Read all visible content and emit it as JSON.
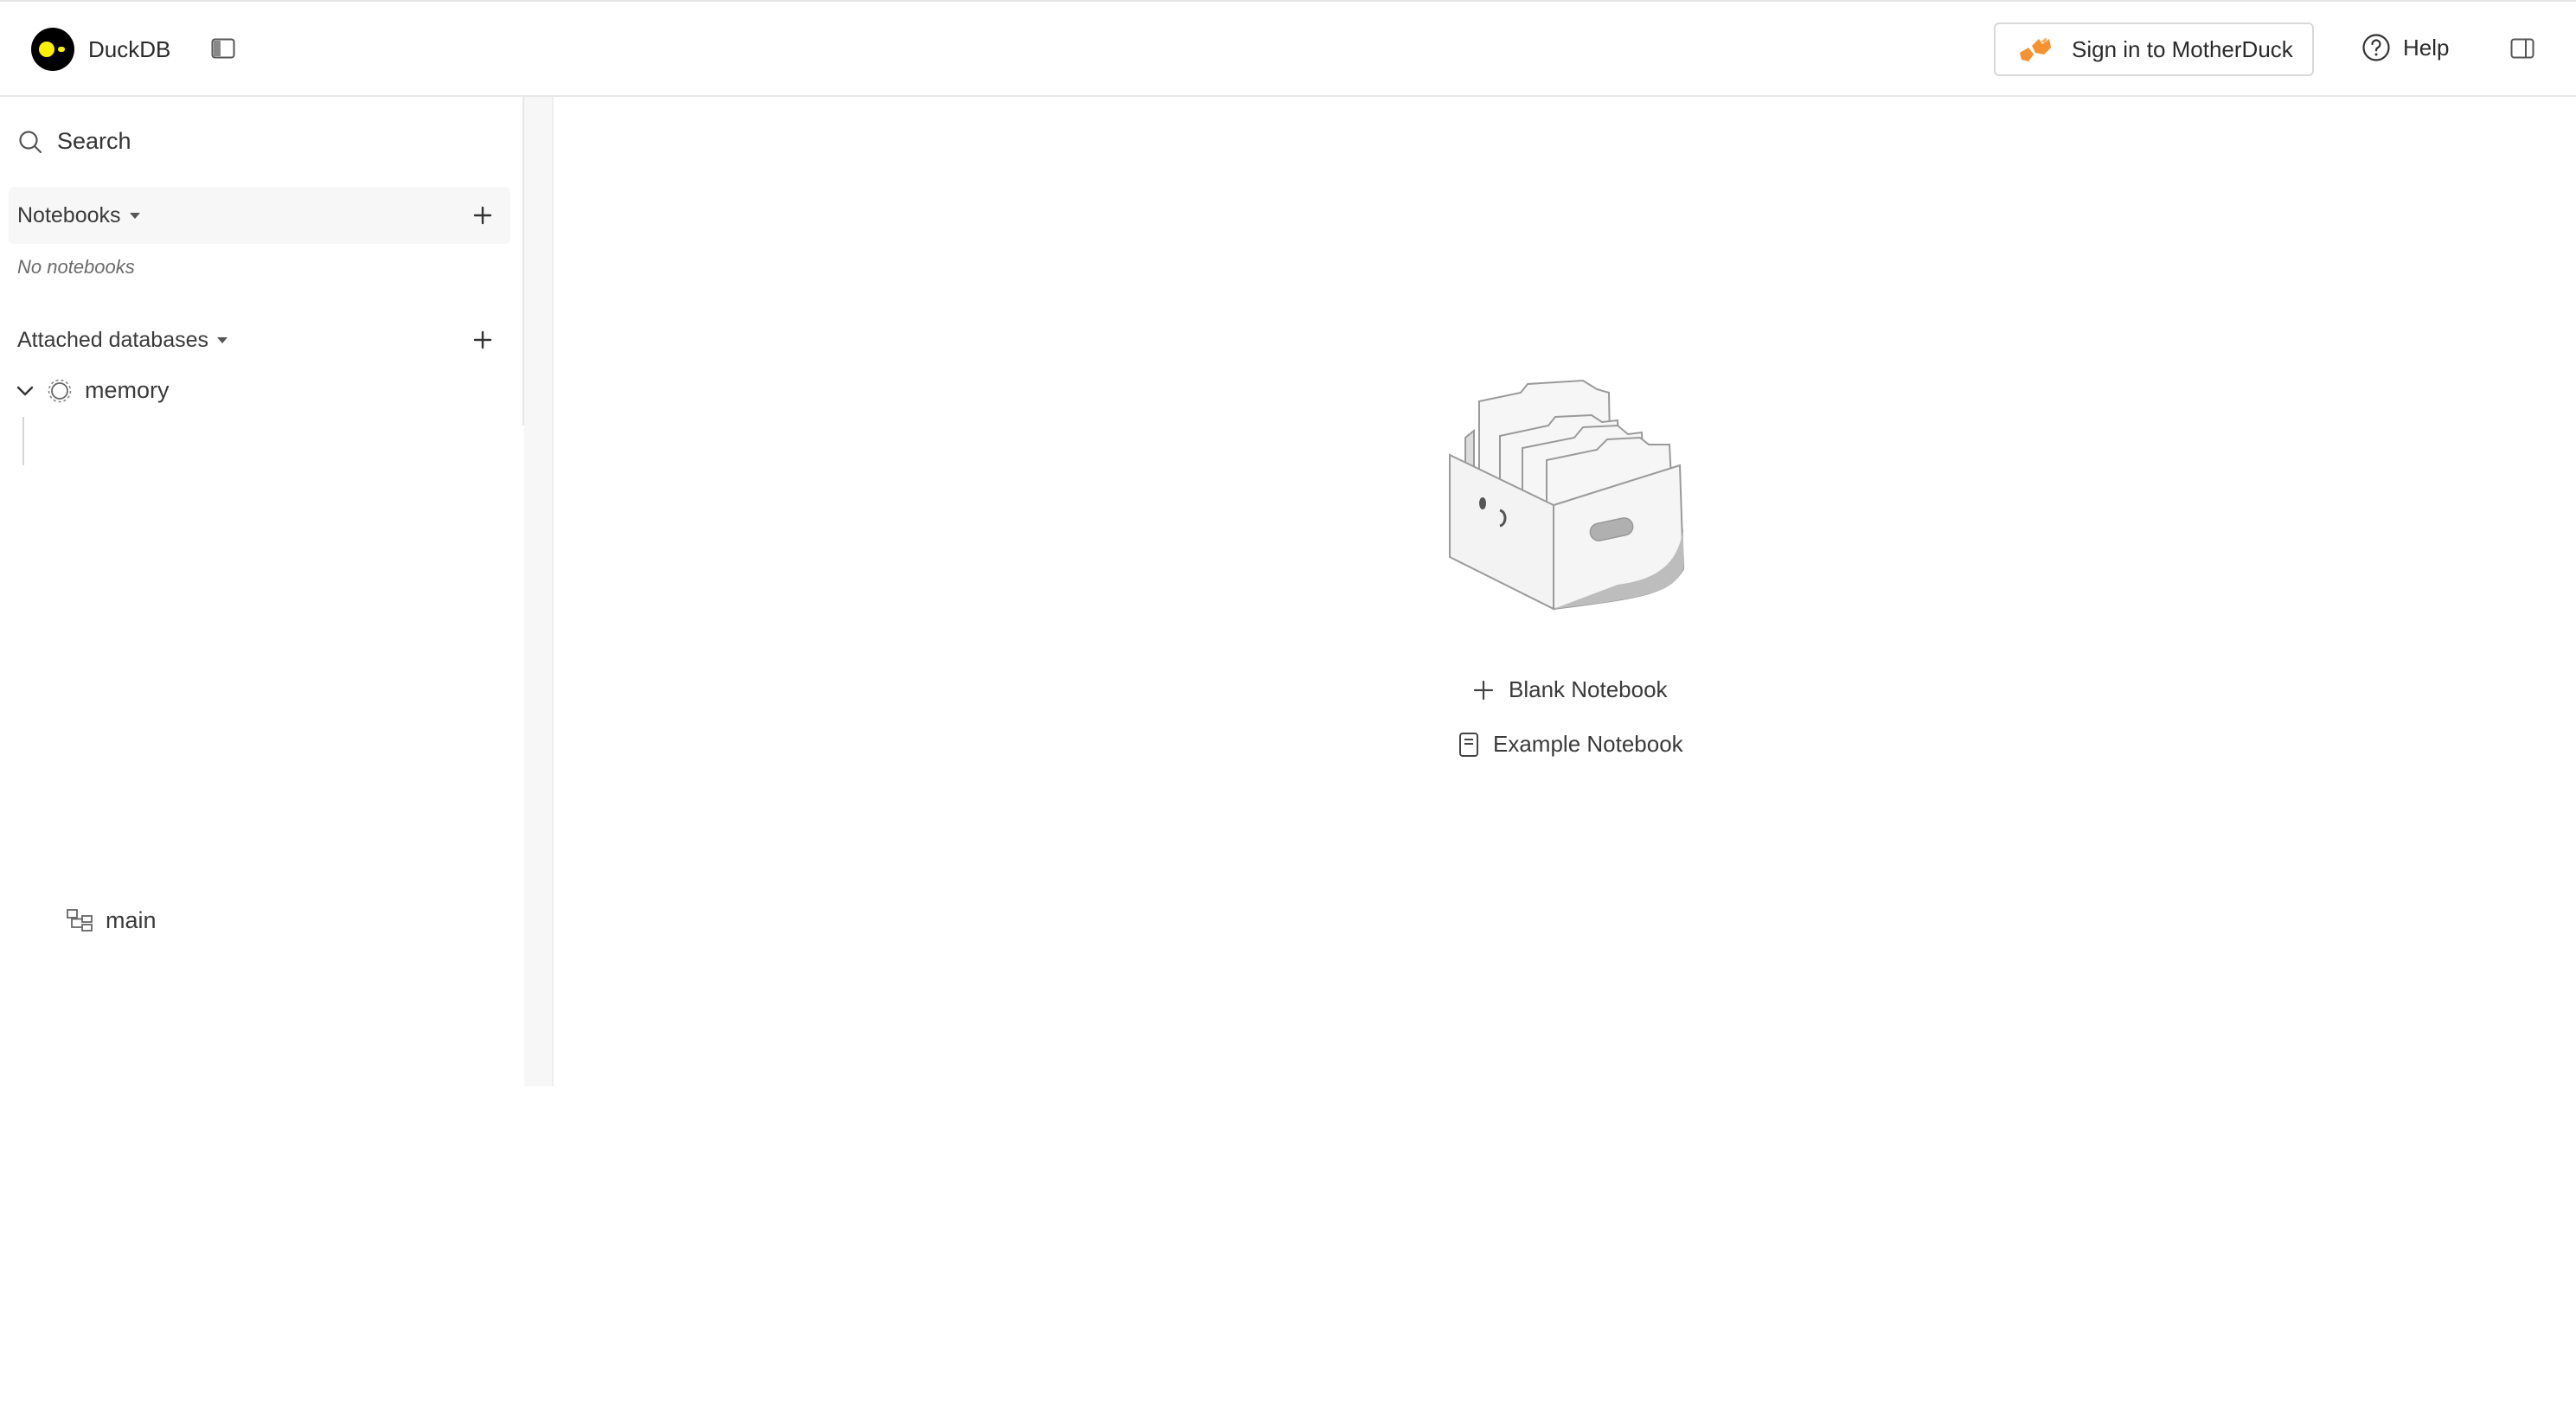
{
  "header": {
    "app_name": "DuckDB",
    "signin_label": "Sign in to MotherDuck",
    "help_label": "Help"
  },
  "sidebar": {
    "search_label": "Search",
    "notebooks": {
      "title": "Notebooks",
      "empty_text": "No notebooks"
    },
    "databases": {
      "title": "Attached databases",
      "items": [
        {
          "name": "memory",
          "expanded": true,
          "schemas": [
            {
              "name": "main"
            }
          ]
        }
      ]
    }
  },
  "main": {
    "blank_notebook_label": "Blank Notebook",
    "example_notebook_label": "Example Notebook"
  },
  "icons": {
    "logo": "duckdb-logo-icon",
    "sidebar_toggle": "sidebar-toggle-icon",
    "motherduck": "motherduck-logo-icon",
    "help": "question-circle-icon",
    "panel_toggle": "right-panel-toggle-icon",
    "search": "search-icon",
    "add": "plus-icon",
    "chevron": "chevron-down-icon",
    "database": "database-gear-icon",
    "schema": "schema-icon",
    "notebook": "notebook-icon"
  },
  "colors": {
    "logo_yellow": "#fff100",
    "motherduck_orange": "#f5922f",
    "border": "#e6e6e6"
  }
}
